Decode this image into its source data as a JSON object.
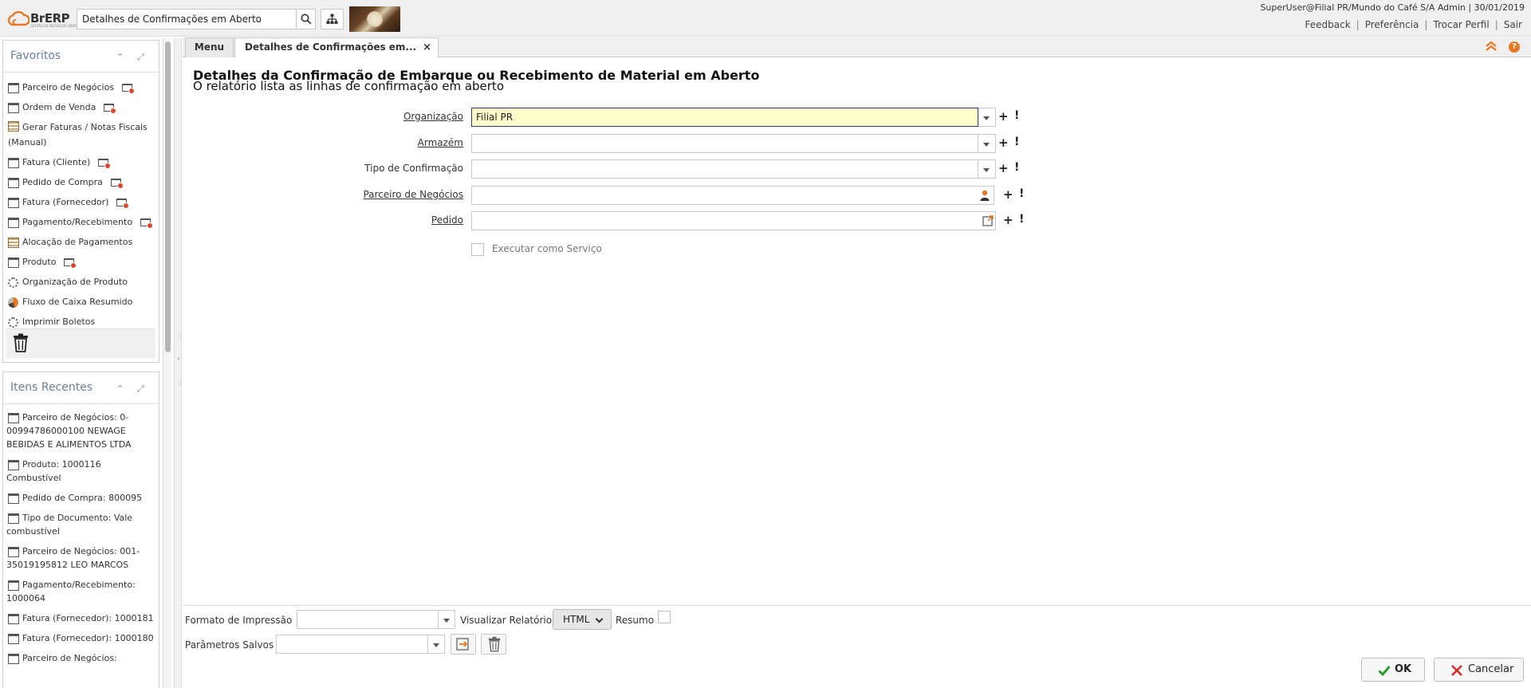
{
  "app": {
    "brand": "BrERP",
    "brand_sub": "GESTÃO DE NEGÓCIOS ABERTA",
    "search_value": "Detalhes de Confirmações em Aberto"
  },
  "user": {
    "info": "SuperUser@Filial PR/Mundo do Café S/A Admin | 30/01/2019",
    "links": [
      "Feedback",
      "Preferência",
      "Trocar Perfil",
      "Sair"
    ]
  },
  "favorites": {
    "title": "Favoritos",
    "items": [
      {
        "label": "Parceiro de Negócios",
        "icon": "window-icon",
        "newwin": true
      },
      {
        "label": "Ordem de Venda",
        "icon": "window-icon",
        "newwin": true
      },
      {
        "label": "Gerar Faturas / Notas Fiscais (Manual)",
        "icon": "form-icon",
        "newwin": false
      },
      {
        "label": "Fatura (Cliente)",
        "icon": "window-icon",
        "newwin": true
      },
      {
        "label": "Pedido de Compra",
        "icon": "window-icon",
        "newwin": true
      },
      {
        "label": "Fatura (Fornecedor)",
        "icon": "window-icon",
        "newwin": true
      },
      {
        "label": "Pagamento/Recebimento",
        "icon": "window-icon",
        "newwin": true
      },
      {
        "label": "Alocação de Pagamentos",
        "icon": "form-icon",
        "newwin": false
      },
      {
        "label": "Produto",
        "icon": "window-icon",
        "newwin": true
      },
      {
        "label": "Organização de Produto",
        "icon": "process-gear-icon",
        "newwin": false
      },
      {
        "label": "Fluxo de Caixa Resumido",
        "icon": "report-pie-icon",
        "newwin": false
      },
      {
        "label": "Imprimir Boletos",
        "icon": "process-gear-icon",
        "newwin": false
      }
    ]
  },
  "recent": {
    "title": "Itens Recentes",
    "items": [
      "Parceiro de Negócios: 0-00994786000100 NEWAGE BEBIDAS E ALIMENTOS LTDA",
      "Produto: 1000116 Combustível",
      "Pedido de Compra: 800095",
      "Tipo de Documento: Vale combustível",
      "Parceiro de Negócios: 001-35019195812 LEO MARCOS",
      "Pagamento/Recebimento: 1000064",
      "Fatura (Fornecedor): 1000181",
      "Fatura (Fornecedor): 1000180",
      "Parceiro de Negócios:"
    ]
  },
  "tabs": {
    "menu": "Menu",
    "current": "Detalhes de Confirmações em..."
  },
  "process": {
    "title": "Detalhes da Confirmação de Embarque ou Recebimento de Material em Aberto",
    "description": "O relatório lista as linhas de confirmação em aberto"
  },
  "fields": {
    "org": {
      "label": "Organização",
      "value": "Filial PR"
    },
    "warehouse": {
      "label": "Armazém",
      "value": ""
    },
    "conf_type": {
      "label": "Tipo de Confirmação",
      "value": ""
    },
    "bpartner": {
      "label": "Parceiro de Negócios",
      "value": ""
    },
    "order": {
      "label": "Pedido",
      "value": ""
    }
  },
  "run_as_service": "Executar como Serviço",
  "bottom": {
    "print_format_label": "Formato de Impressão",
    "view_report_label": "Visualizar Relatório",
    "view_report_value": "HTML",
    "summary_label": "Resumo",
    "saved_params_label": "Parâmetros Salvos"
  },
  "actions": {
    "ok": "OK",
    "cancel": "Cancelar"
  },
  "colors": {
    "accent": "#e87722",
    "active_field": "#ffffcc",
    "ok_check": "#2e9b2e",
    "cancel_x": "#d22b2b"
  }
}
